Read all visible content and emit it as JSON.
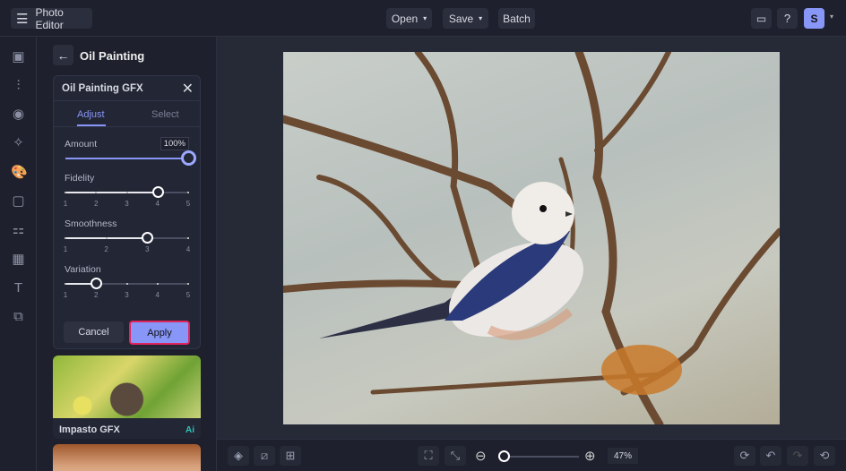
{
  "topbar": {
    "app_title": "Photo Editor",
    "open": "Open",
    "save": "Save",
    "batch": "Batch",
    "avatar_initial": "S"
  },
  "panel": {
    "title": "Oil Painting",
    "card_title": "Oil Painting GFX",
    "tabs": [
      "Adjust",
      "Select"
    ],
    "amount": {
      "label": "Amount",
      "value": "100%",
      "fraction": 1.0
    },
    "fidelity": {
      "label": "Fidelity",
      "ticks": [
        "1",
        "2",
        "3",
        "4",
        "5"
      ],
      "value": 4
    },
    "smoothness": {
      "label": "Smoothness",
      "ticks": [
        "1",
        "2",
        "3",
        "4"
      ],
      "value": 3
    },
    "variation": {
      "label": "Variation",
      "ticks": [
        "1",
        "2",
        "3",
        "4",
        "5"
      ],
      "value": 2
    },
    "cancel": "Cancel",
    "apply": "Apply",
    "presets": [
      {
        "name": "Impasto GFX",
        "badge": "Ai"
      }
    ]
  },
  "bottombar": {
    "zoom": "47%",
    "zoom_fraction": 0.05
  },
  "colors": {
    "accent": "#8796f7",
    "highlight": "#e0245e",
    "ai_badge": "#2ec4b6"
  }
}
